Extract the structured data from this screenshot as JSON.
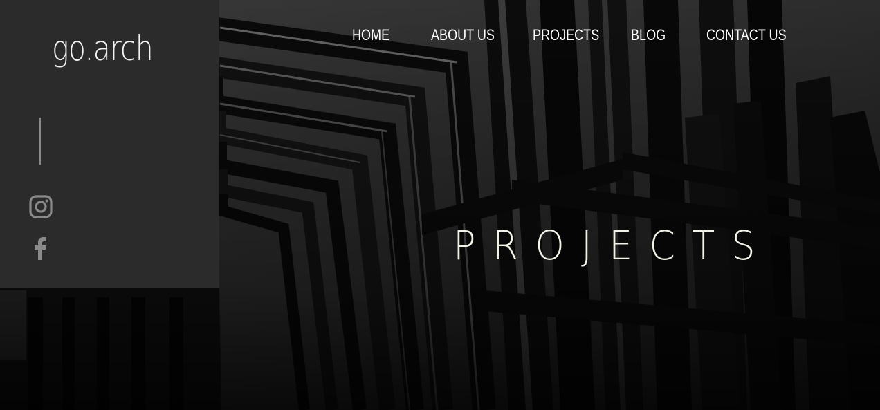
{
  "brand": {
    "logo_text": "go.arch"
  },
  "nav": {
    "items": [
      {
        "label": "HOME"
      },
      {
        "label": "ABOUT US"
      },
      {
        "label": "PROJECTS"
      },
      {
        "label": "BLOG"
      },
      {
        "label": "CONTACT US"
      }
    ]
  },
  "social": {
    "icons": [
      "instagram-icon",
      "facebook-icon"
    ]
  },
  "hero": {
    "title": "PROJECTS",
    "background": "black-and-white architectural facade with tall vertical beams"
  },
  "colors": {
    "panel": "#2b2b2b",
    "icon": "#8a8a8a",
    "title": "#f3f3e6",
    "nav_text": "#ffffff"
  }
}
